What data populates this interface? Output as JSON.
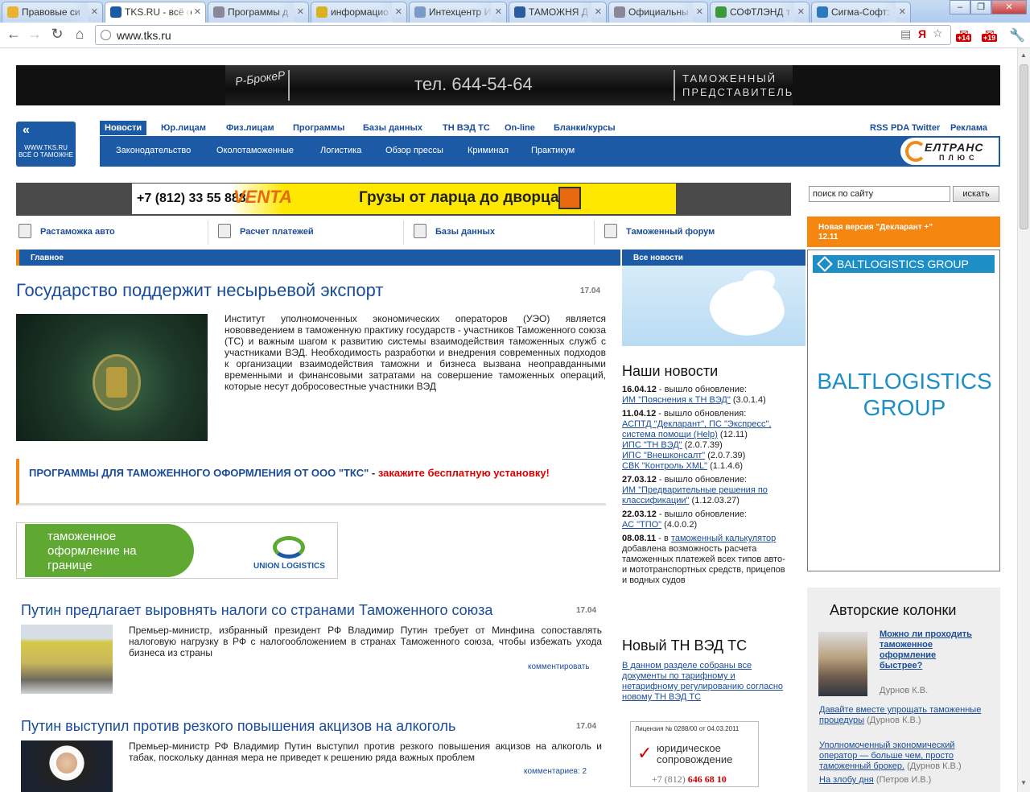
{
  "browser": {
    "tabs": [
      {
        "label": "Правовые си"
      },
      {
        "label": "TKS.RU - всё о"
      },
      {
        "label": "Программы д"
      },
      {
        "label": "информацио"
      },
      {
        "label": "Интехцентр И"
      },
      {
        "label": "ТАМОЖНЯ Д"
      },
      {
        "label": "Официальны"
      },
      {
        "label": "СОФТЛЭНД т"
      },
      {
        "label": "Сигма-Софт:"
      }
    ],
    "url": "www.tks.ru",
    "badge1": "+14",
    "badge2": "+19"
  },
  "top_banner": {
    "brand": "Р-БрокеР",
    "phone": "тел. 644-54-64",
    "line1": "ТАМОЖЕННЫЙ",
    "line2": "ПРЕДСТАВИТЕЛЬ"
  },
  "logo": {
    "line1": "WWW.TKS.RU",
    "line2": "ВСЁ О ТАМОЖНЕ"
  },
  "nav_top": [
    "Новости",
    "Юр.лицам",
    "Физ.лицам",
    "Программы",
    "Базы данных",
    "ТН ВЭД ТС",
    "On-line",
    "Бланки/курсы"
  ],
  "nav_right": [
    "RSS",
    "PDA",
    "Twitter",
    "Реклама"
  ],
  "nav_sub": [
    "Законодательство",
    "Околотаможенные",
    "Логистика",
    "Обзор прессы",
    "Криминал",
    "Практикум"
  ],
  "eltrans": {
    "title": "ЕЛТРАНС",
    "sub": "ПЛЮС"
  },
  "venta": {
    "phone": "+7 (812) 33 55 888",
    "logo": "VENTA",
    "slogan": "Грузы от ларца до дворца"
  },
  "search": {
    "placeholder": "поиск по сайту",
    "button": "искать"
  },
  "quick_links": [
    "Растаможка авто",
    "Расчет платежей",
    "Базы данных",
    "Таможенный форум"
  ],
  "declarant": {
    "prefix": "Новая версия \"",
    "link": "Декларант +",
    "suffix": "\"",
    "version": "12.11"
  },
  "sections": {
    "main": "Главное",
    "all_news": "Все новости"
  },
  "lead": {
    "title": "Государство поддержит несырьевой экспорт",
    "date": "17.04",
    "text": "Институт уполномоченных экономических операторов (УЭО) является нововведением в таможенную практику государств - участников Таможенного союза (ТС) и важным шагом к развитию системы взаимодействия таможенных служб с участниками ВЭД. Необходимость разработки и внедрения современных подходов к организации взаимодействия таможни и бизнеса вызвана неоправданными временными и финансовыми затратами на совершение таможенных операций, которые несут добросовестные участники ВЭД"
  },
  "promo": {
    "part1": "ПРОГРАММЫ ДЛЯ ТАМОЖЕННОГО ОФОРМЛЕНИЯ ОТ ООО \"ТКС\"",
    "sep": " - ",
    "part2": "закажите бесплатную установку!"
  },
  "union_banner": {
    "text": "таможенное оформление на границе",
    "logo": "UNION LOGISTICS"
  },
  "news_items": [
    {
      "title": "Путин предлагает выровнять налоги со странами Таможенного союза",
      "date": "17.04",
      "text": "Премьер-министр, избранный президент РФ Владимир Путин требует от Минфина сопоставлять налоговую нагрузку в РФ с налогообложением в странах Таможенного союза, чтобы избежать ухода бизнеса из страны",
      "comment": "комментировать"
    },
    {
      "title": "Путин выступил против резкого повышения акцизов на алкоголь",
      "date": "17.04",
      "text": "Премьер-министр РФ Владимир Путин выступил против резкого повышения акцизов на алкоголь и табак, поскольку данная мера не приведет к решению ряда важных проблем",
      "comment": "комментариев: 2"
    }
  ],
  "our_news": {
    "title": "Наши новости",
    "entries": [
      {
        "date": "16.04.12",
        "pre": " - вышло обновление:",
        "items": [
          {
            "link": "ИМ \"Пояснения к ТН ВЭД\"",
            "ver": " (3.0.1.4)"
          }
        ]
      },
      {
        "date": "11.04.12",
        "pre": " - вышло обновления:",
        "items": [
          {
            "link": "АСПТД \"Декларант\", ПС \"Экспресс\", система помощи (Help)",
            "ver": " (12.11)"
          },
          {
            "link": "ИПС \"ТН ВЭД\"",
            "ver": " (2.0.7.39)"
          },
          {
            "link": "ИПС \"Внешконсалт\"",
            "ver": " (2.0.7.39)"
          },
          {
            "link": "СВК \"Контроль XML\"",
            "ver": " (1.1.4.6)"
          }
        ]
      },
      {
        "date": "27.03.12",
        "pre": " - вышло обновление:",
        "items": [
          {
            "link": "ИМ \"Предварительные решения по классификации\"",
            "ver": " (1.12.03.27)"
          }
        ]
      },
      {
        "date": "22.03.12",
        "pre": " - вышло обновление:",
        "items": [
          {
            "link": "АС \"ТПО\"",
            "ver": " (4.0.0.2)"
          }
        ]
      }
    ],
    "last": {
      "date": "08.08.11",
      "pre": " - в ",
      "link": "таможенный калькулятор",
      "post": " добавлена возможность расчета таможенных платежей всех типов авто- и мототранспортных средств, прицепов и водных судов"
    }
  },
  "new_tnved": {
    "title": "Новый ТН ВЭД ТС",
    "text": "В данном разделе собраны все документы по тарифному и нетарифному регулированию согласно новому ТН ВЭД ТС"
  },
  "license": {
    "title": "Лицензия № 0288/00 от 04.03.2011",
    "main": "юридическое сопровождение",
    "phone_prefix": "+7 (812)",
    "phone": "646 68 10"
  },
  "baltic": {
    "bar": "BALTLOGISTICS GROUP",
    "line1": "BALTLOGISTICS",
    "line2": "GROUP"
  },
  "authors": {
    "title": "Авторские колонки",
    "question": "Можно ли проходить таможенное оформление быстрее?",
    "author": "Дурнов К.В.",
    "links": [
      {
        "link": "Давайте вместе упрощать таможенные процедуры",
        "author": " (Дурнов К.В.)"
      },
      {
        "link": "Уполномоченный экономический оператор — больше чем, просто таможенный брокер.",
        "author": " (Дурнов К.В.)"
      },
      {
        "link": "На злобу дня",
        "author": " (Петров И.В.)"
      }
    ]
  }
}
